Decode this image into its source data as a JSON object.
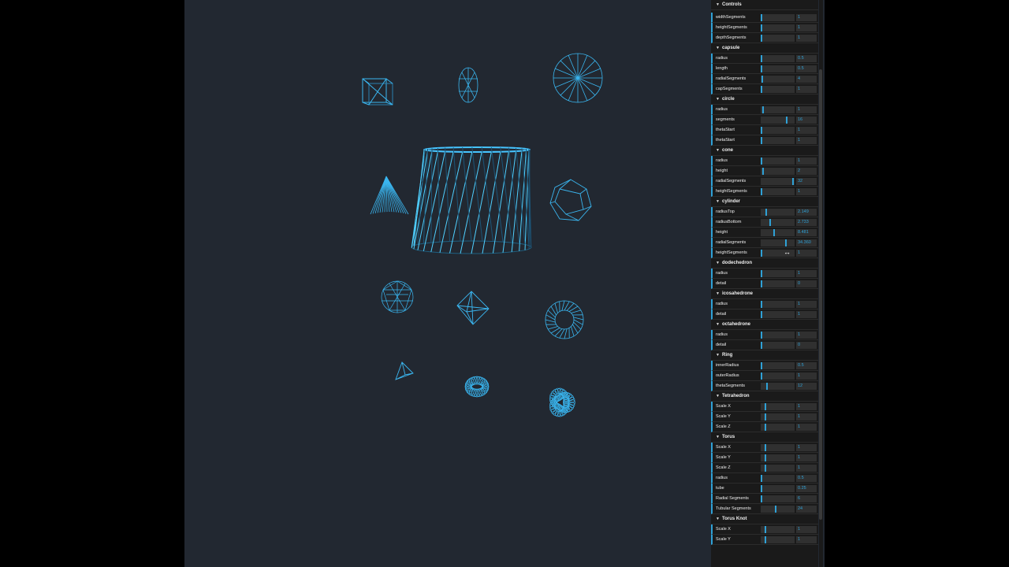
{
  "gui": {
    "root_title": "Controls",
    "folders": [
      {
        "name": "",
        "params": [
          {
            "label": "widthSegments",
            "value": "1",
            "fill": 0.02
          },
          {
            "label": "heightSegments",
            "value": "1",
            "fill": 0.02
          },
          {
            "label": "depthSegments",
            "value": "1",
            "fill": 0.02
          }
        ]
      },
      {
        "name": "capsule",
        "params": [
          {
            "label": "radius",
            "value": "0.5",
            "fill": 0.04
          },
          {
            "label": "length",
            "value": "0.5",
            "fill": 0.03
          },
          {
            "label": "radialSegments",
            "value": "4",
            "fill": 0.06
          },
          {
            "label": "capSegments",
            "value": "1",
            "fill": 0.01
          }
        ]
      },
      {
        "name": "circle",
        "params": [
          {
            "label": "radius",
            "value": "1",
            "fill": 0.1
          },
          {
            "label": "segments",
            "value": "16",
            "fill": 0.78
          },
          {
            "label": "thetaStart",
            "value": "1",
            "fill": 0.02
          },
          {
            "label": "thetaStart",
            "value": "1",
            "fill": 0.02
          }
        ]
      },
      {
        "name": "cone",
        "params": [
          {
            "label": "radius",
            "value": "1",
            "fill": 0.03
          },
          {
            "label": "height",
            "value": "2",
            "fill": 0.1
          },
          {
            "label": "radialSegments",
            "value": "32",
            "fill": 0.97
          },
          {
            "label": "heightSegments",
            "value": "1",
            "fill": 0.02
          }
        ]
      },
      {
        "name": "cylinder",
        "params": [
          {
            "label": "radiusTop",
            "value": "2.149",
            "fill": 0.18
          },
          {
            "label": "radiusBottom",
            "value": "2.733",
            "fill": 0.3
          },
          {
            "label": "height",
            "value": "8.481",
            "fill": 0.42
          },
          {
            "label": "radialSegments",
            "value": "34.360",
            "fill": 0.76
          },
          {
            "label": "heightSegments",
            "value": "1",
            "fill": 0.02
          }
        ]
      },
      {
        "name": "dodechedron",
        "params": [
          {
            "label": "radius",
            "value": "1",
            "fill": 0.04
          },
          {
            "label": "detail",
            "value": "0",
            "fill": 0.02
          }
        ]
      },
      {
        "name": "icosahedrone",
        "params": [
          {
            "label": "radius",
            "value": "1",
            "fill": 0.04
          },
          {
            "label": "detail",
            "value": "1",
            "fill": 0.02
          }
        ]
      },
      {
        "name": "octahedrone",
        "params": [
          {
            "label": "radius",
            "value": "1",
            "fill": 0.04
          },
          {
            "label": "detail",
            "value": "0",
            "fill": 0.02
          }
        ]
      },
      {
        "name": "Ring",
        "params": [
          {
            "label": "innerRadius",
            "value": "0.5",
            "fill": 0.04
          },
          {
            "label": "outerRadius",
            "value": "1",
            "fill": 0.04
          },
          {
            "label": "thetaSegments",
            "value": "12",
            "fill": 0.22
          }
        ]
      },
      {
        "name": "Tetrahedron",
        "params": [
          {
            "label": "Scale X",
            "value": "1",
            "fill": 0.17
          },
          {
            "label": "Scale Y",
            "value": "1",
            "fill": 0.17
          },
          {
            "label": "Scale Z",
            "value": "1",
            "fill": 0.17
          }
        ]
      },
      {
        "name": "Torus",
        "params": [
          {
            "label": "Scale X",
            "value": "1",
            "fill": 0.17
          },
          {
            "label": "Scale Y",
            "value": "1",
            "fill": 0.17
          },
          {
            "label": "Scale Z",
            "value": "1",
            "fill": 0.17
          },
          {
            "label": "radius",
            "value": "0.5",
            "fill": 0.04
          },
          {
            "label": "tube",
            "value": "0.25",
            "fill": 0.03
          },
          {
            "label": "Radial Segments",
            "value": "6",
            "fill": 0.02
          },
          {
            "label": "Tubular Segments",
            "value": "24",
            "fill": 0.46
          }
        ]
      },
      {
        "name": "Torus Knot",
        "params": [
          {
            "label": "Scale X",
            "value": "1",
            "fill": 0.17
          },
          {
            "label": "Scale Y",
            "value": "1",
            "fill": 0.17
          }
        ]
      }
    ]
  },
  "colors": {
    "background": "#222831",
    "wire": "#3ab6f0",
    "gui_bg": "#1a1a1a",
    "accent": "#2fa1d6"
  }
}
